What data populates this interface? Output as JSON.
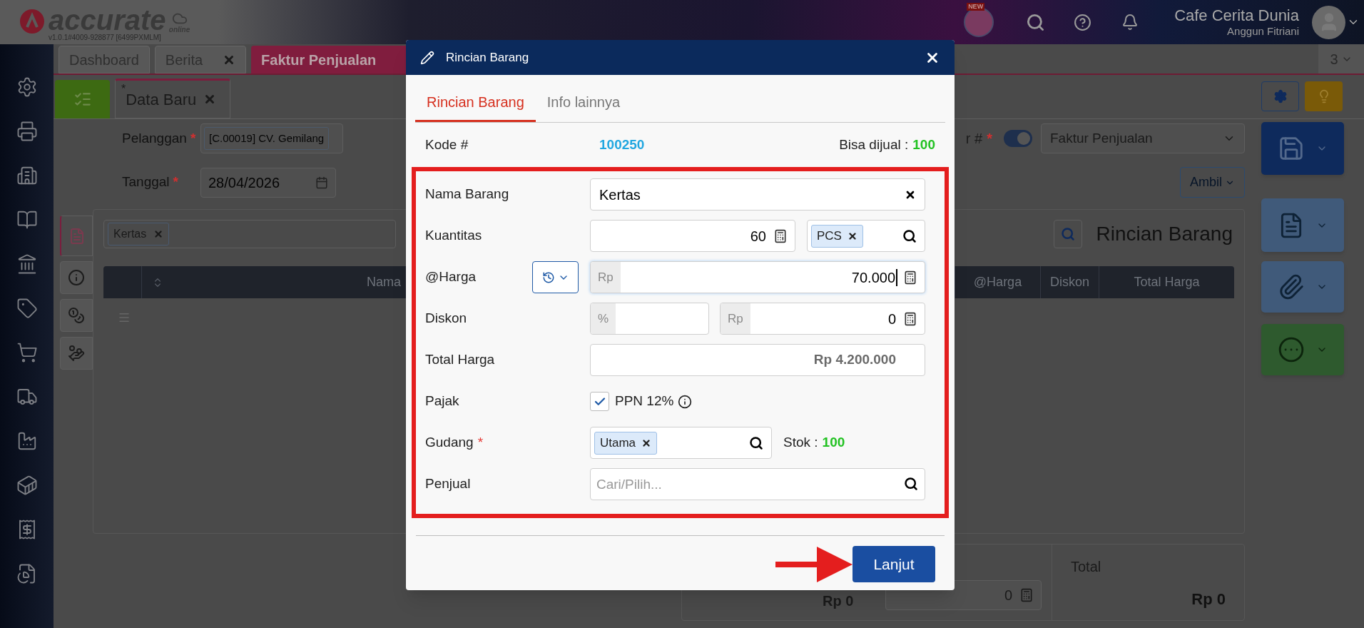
{
  "header": {
    "logo_text": "accurate",
    "logo_sub": "online",
    "version": "v1.0.1#4009-928877 [6499PXMLM]",
    "badge": "NEW",
    "company": "Cafe Cerita Dunia",
    "user": "Anggun Fitriani"
  },
  "page_tabs": [
    {
      "label": "Dashboard",
      "selected": false,
      "closable": false
    },
    {
      "label": "Berita",
      "selected": false,
      "closable": true
    },
    {
      "label": "Faktur Penjualan",
      "selected": true,
      "closable": false
    }
  ],
  "tab_count": "3",
  "doc_tab": {
    "marker": "*",
    "label": "Data Baru"
  },
  "form": {
    "fields": [
      {
        "kind": "lookup",
        "label": "Pelanggan",
        "required_mark": "*",
        "value": "[C.00019] CV. Gemilang"
      },
      {
        "kind": "date",
        "label": "Tanggal",
        "required_mark": "*",
        "value": "28/04/2026"
      }
    ],
    "number_label": "r #",
    "number_required_mark": "*",
    "auto_number": {
      "on": true
    },
    "type_select": "Faktur Penjualan",
    "take_button": "Ambil"
  },
  "side_tabs": [
    {
      "selected": true
    },
    {
      "selected": false
    },
    {
      "selected": false
    },
    {
      "selected": false
    }
  ],
  "items_panel": {
    "chips": [
      "Kertas"
    ],
    "title": "Rincian Barang",
    "columns": [
      {
        "label": "Nama"
      },
      {
        "label": "@Harga"
      },
      {
        "label": "Diskon"
      },
      {
        "label": "Total Harga"
      }
    ]
  },
  "summary": {
    "subtotal": "Rp 0",
    "amount": "0",
    "total_label": "Total",
    "total": "Rp 0"
  },
  "dialog": {
    "title": "Rincian Barang",
    "tabs": [
      {
        "label": "Rincian Barang",
        "selected": true
      },
      {
        "label": "Info lainnya",
        "selected": false
      }
    ],
    "code_label": "Kode #",
    "code": "100250",
    "sellable_label": "Bisa dijual :",
    "sellable": "100",
    "name": {
      "label": "Nama Barang",
      "value": "Kertas"
    },
    "quantity": {
      "label": "Kuantitas",
      "value": "60",
      "unit": "PCS"
    },
    "price": {
      "label": "@Harga",
      "prefix": "Rp",
      "value": "70.000"
    },
    "discount": {
      "label": "Diskon",
      "percent_prefix": "%",
      "amount_prefix": "Rp",
      "amount": "0"
    },
    "total": {
      "label": "Total Harga",
      "value": "Rp 4.200.000"
    },
    "tax": {
      "label": "Pajak",
      "option": "PPN 12%",
      "checked": true
    },
    "warehouse": {
      "label": "Gudang",
      "required_mark": "*",
      "value": "Utama",
      "stock_label": "Stok :",
      "stock": "100"
    },
    "salesperson": {
      "label": "Penjual",
      "placeholder": "Cari/Pilih..."
    },
    "next_button": "Lanjut"
  }
}
